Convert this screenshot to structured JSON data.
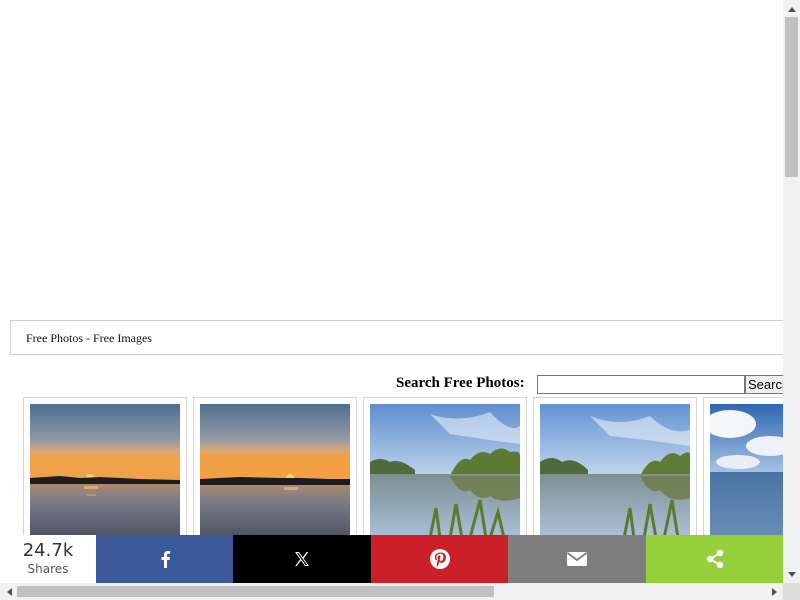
{
  "breadcrumb": {
    "text": "Free Photos - Free Images"
  },
  "search": {
    "label": "Search Free Photos:",
    "value": "",
    "placeholder": "",
    "button_label": "Search"
  },
  "thumbnails": [
    {
      "subject": "sunset over lake"
    },
    {
      "subject": "sunset over lake"
    },
    {
      "subject": "lake with trees reflection"
    },
    {
      "subject": "lake with trees reflection"
    },
    {
      "subject": "lake with clouds"
    }
  ],
  "share": {
    "count": "24.7k",
    "count_label": "Shares",
    "buttons": [
      {
        "icon": "facebook-icon",
        "color": "#3b5998"
      },
      {
        "icon": "x-icon",
        "color": "#000000"
      },
      {
        "icon": "pinterest-icon",
        "color": "#cb2027"
      },
      {
        "icon": "email-icon",
        "color": "#7d7d7d"
      },
      {
        "icon": "share-icon",
        "color": "#95d03a"
      }
    ]
  }
}
